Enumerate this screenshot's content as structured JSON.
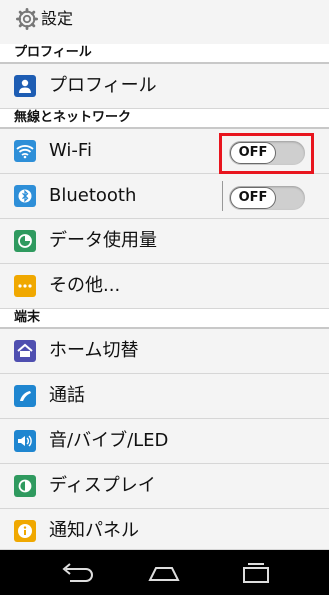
{
  "header": {
    "title": "設定",
    "icon": "gear-icon"
  },
  "sections": {
    "profile": "プロフィール",
    "wireless": "無線とネットワーク",
    "device": "端末"
  },
  "items": {
    "profile": {
      "label": "プロフィール",
      "icon": "person-icon",
      "color": "#1e5db3"
    },
    "wifi": {
      "label": "Wi-Fi",
      "icon": "wifi-icon",
      "color": "#2e8fd8",
      "toggle": "OFF"
    },
    "bluetooth": {
      "label": "Bluetooth",
      "icon": "bluetooth-icon",
      "color": "#2e8fd8",
      "toggle": "OFF"
    },
    "data_usage": {
      "label": "データ使用量",
      "icon": "data-usage-icon",
      "color": "#2f9a5f"
    },
    "more": {
      "label": "その他...",
      "icon": "more-icon",
      "color": "#f0a800"
    },
    "home": {
      "label": "ホーム切替",
      "icon": "home-icon",
      "color": "#4f4fb0"
    },
    "call": {
      "label": "通話",
      "icon": "phone-icon",
      "color": "#1f86d0"
    },
    "sound": {
      "label": "音/バイブ/LED",
      "icon": "speaker-icon",
      "color": "#1f86d0"
    },
    "display": {
      "label": "ディスプレイ",
      "icon": "display-icon",
      "color": "#2f9a5f"
    },
    "notification": {
      "label": "通知パネル",
      "icon": "info-icon",
      "color": "#f0a800"
    }
  },
  "navbar": {
    "back": "back-icon",
    "home": "home-nav-icon",
    "recents": "recents-icon"
  }
}
